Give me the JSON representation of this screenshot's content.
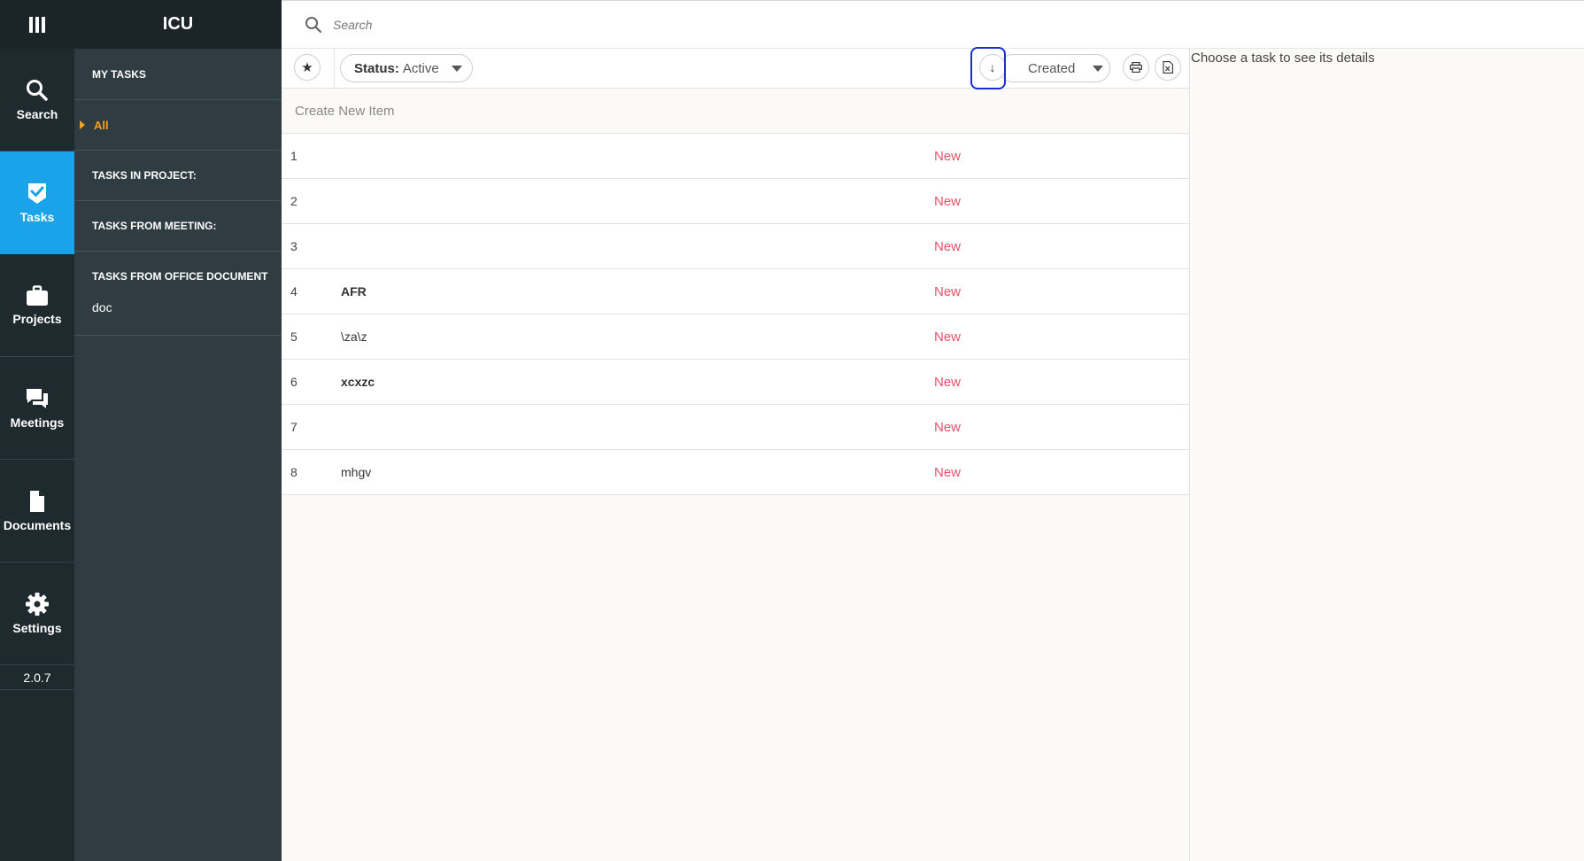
{
  "app": {
    "title": "ICU",
    "version": "2.0.7"
  },
  "rail": {
    "items": [
      {
        "label": "Search",
        "icon": "search-icon"
      },
      {
        "label": "Tasks",
        "icon": "tasks-check-icon"
      },
      {
        "label": "Projects",
        "icon": "briefcase-icon"
      },
      {
        "label": "Meetings",
        "icon": "chat-bubbles-icon"
      },
      {
        "label": "Documents",
        "icon": "document-icon"
      },
      {
        "label": "Settings",
        "icon": "gear-icon"
      }
    ],
    "active": "Tasks"
  },
  "sidebar": {
    "my_tasks": "MY TASKS",
    "all": "All",
    "tasks_in_project": "TASKS IN PROJECT:",
    "tasks_from_meeting": "TASKS FROM MEETING:",
    "tasks_from_office_document": "TASKS FROM OFFICE DOCUMENT",
    "office_doc_item": "doc"
  },
  "search": {
    "placeholder": "Search"
  },
  "toolbar": {
    "status_label": "Status:",
    "status_value": "Active",
    "sort_value": "Created",
    "sort_direction_glyph": "↓"
  },
  "list": {
    "create_new": "Create New Item",
    "rows": [
      {
        "num": "1",
        "title": "",
        "bold": false,
        "status": "New"
      },
      {
        "num": "2",
        "title": "",
        "bold": false,
        "status": "New"
      },
      {
        "num": "3",
        "title": "",
        "bold": false,
        "status": "New"
      },
      {
        "num": "4",
        "title": "AFR",
        "bold": true,
        "status": "New"
      },
      {
        "num": "5",
        "title": "\\za\\z",
        "bold": false,
        "status": "New"
      },
      {
        "num": "6",
        "title": "xcxzc",
        "bold": true,
        "status": "New"
      },
      {
        "num": "7",
        "title": "",
        "bold": false,
        "status": "New"
      },
      {
        "num": "8",
        "title": "mhgv",
        "bold": false,
        "status": "New"
      }
    ]
  },
  "details": {
    "hint": "Choose a task to see its details"
  },
  "colors": {
    "rail_bg": "#1e2a2e",
    "sidebar_bg": "#2f3d42",
    "accent": "#1aa3e8",
    "active_filter": "#f7a21b",
    "status_new": "#e8516a",
    "annotation": "#1a2fd0"
  }
}
